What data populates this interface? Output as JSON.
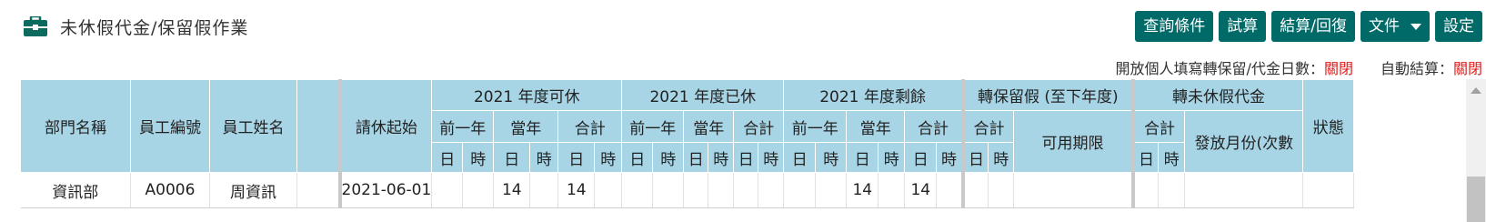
{
  "page": {
    "title": "未休假代金/保留假作業",
    "icon": "briefcase-icon"
  },
  "toolbar": {
    "query": "查詢條件",
    "trial": "試算",
    "settle": "結算/回復",
    "file": "文件",
    "settings": "設定"
  },
  "status": {
    "open_label": "開放個人填寫轉保留/代金日數：",
    "open_value": "關閉",
    "auto_label": "自動結算：",
    "auto_value": "關閉",
    "value_color": "#e01818"
  },
  "table": {
    "col_dept": "部門名稱",
    "col_emp_no": "員工編號",
    "col_emp_name": "員工姓名",
    "col_start": "請休起始",
    "group_avail": "2021 年度可休",
    "group_used": "2021 年度已休",
    "group_remain": "2021 年度剩餘",
    "group_transfer": "轉保留假 (至下年度)",
    "group_cash": "轉未休假代金",
    "col_status": "狀態",
    "prev_year": "前一年",
    "this_year": "當年",
    "total": "合計",
    "valid_period": "可用期限",
    "pay_month": "發放月份(次數",
    "day": "日",
    "hour": "時",
    "rows": [
      {
        "dept": "資訊部",
        "emp_no": "A0006",
        "emp_name": "周資訊",
        "start": "2021-06-01",
        "avail_prev_d": "",
        "avail_prev_h": "",
        "avail_cur_d": "14",
        "avail_cur_h": "",
        "avail_tot_d": "14",
        "avail_tot_h": "",
        "used_prev_d": "",
        "used_prev_h": "",
        "used_cur_d": "",
        "used_cur_h": "",
        "used_tot_d": "",
        "used_tot_h": "",
        "rem_prev_d": "",
        "rem_prev_h": "",
        "rem_cur_d": "14",
        "rem_cur_h": "",
        "rem_tot_d": "14",
        "rem_tot_h": "",
        "tr_tot_d": "",
        "tr_tot_h": "",
        "tr_valid": "",
        "cash_tot_d": "",
        "cash_tot_h": "",
        "cash_month": "",
        "status": ""
      }
    ]
  },
  "colors": {
    "header_bg": "#a7d5e6",
    "button_bg": "#006a68"
  }
}
